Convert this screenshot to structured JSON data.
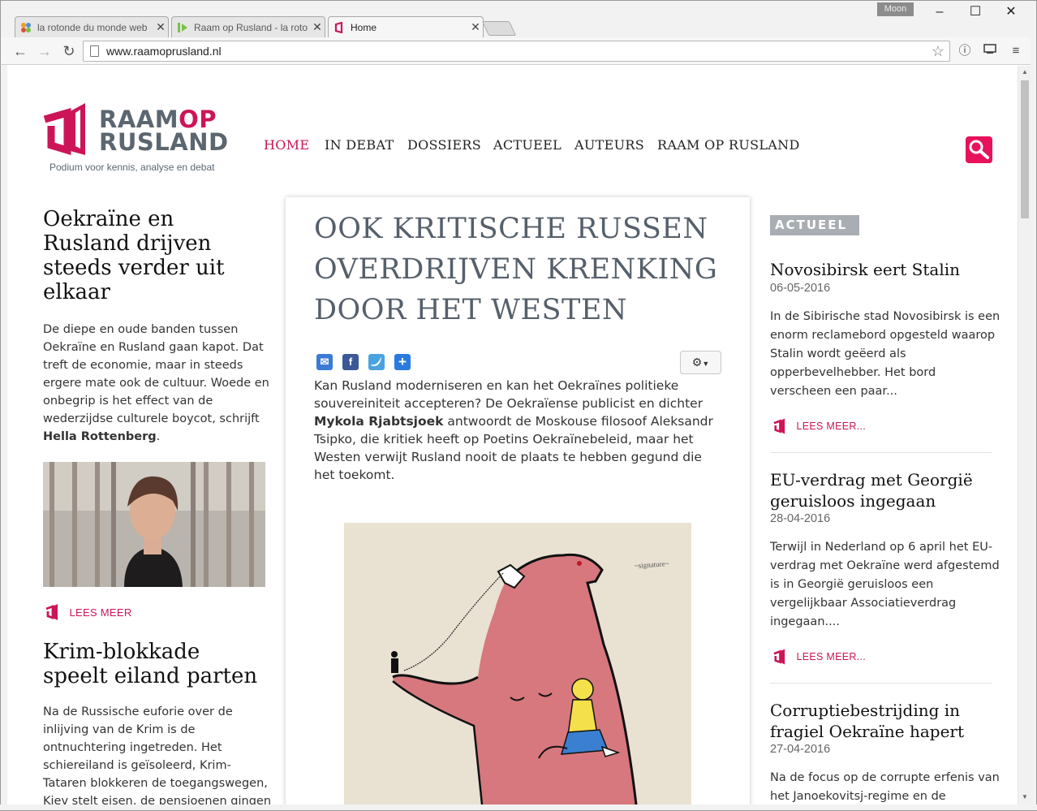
{
  "browser": {
    "tabs": [
      {
        "title": "la rotonde du monde web",
        "favicon": "joomla-icon"
      },
      {
        "title": "Raam op Rusland - la roto",
        "favicon": "green-play-icon"
      },
      {
        "title": "Home",
        "favicon": "raam-op-rusland-icon"
      }
    ],
    "active_tab": 2,
    "user": "Moon",
    "url": "www.raamoprusland.nl",
    "window_controls": {
      "minimize": "–",
      "maximize": "☐",
      "close": "✕"
    }
  },
  "site": {
    "logo": {
      "line1_grey": "RAAM",
      "line1_accent": "OP",
      "line2": "RUSLAND",
      "tagline": "Podium voor kennis, analyse en debat"
    },
    "nav": [
      "HOME",
      "IN DEBAT",
      "DOSSIERS",
      "ACTUEEL",
      "AUTEURS",
      "RAAM OP RUSLAND"
    ],
    "active_nav": "HOME",
    "accent_color": "#cc1557"
  },
  "left": {
    "story1": {
      "title_lines": [
        "Oekraïne en",
        "Rusland drijven",
        "steeds verder uit",
        "elkaar"
      ],
      "lines": [
        "De diepe en oude banden tussen",
        "Oekraïne en Rusland gaan kapot. Dat",
        "treft de economie, maar in steeds",
        "ergere mate ook de cultuur. Woede en",
        "onbegrip is het effect van de",
        "wederzijdse culturele boycot, schrijft"
      ],
      "author": "Hella Rottenberg",
      "author_suffix": ".",
      "lees_meer": "LEES MEER"
    },
    "story2": {
      "title_lines": [
        "Krim-blokkade",
        "speelt eiland parten"
      ],
      "lines": [
        "Na de Russische euforie over de",
        "inlijving van de Krim is de",
        "ontnuchtering ingetreden. Het",
        "schiereiland is geïsoleerd, Krim-",
        "Tataren blokkeren de toegangswegen,",
        "Kiev stelt eisen, de pensioenen gingen"
      ]
    }
  },
  "article": {
    "title_lines": [
      "OOK KRITISCHE RUSSEN",
      "OVERDRIJVEN KRENKING",
      "DOOR HET WESTEN"
    ],
    "share_icons": [
      "email-icon",
      "facebook-icon",
      "twitter-icon",
      "plus-icon"
    ],
    "intro_lines": [
      {
        "pre": "Kan Rusland moderniseren en kan het Oekraïnes politieke",
        "bold": "",
        "post": ""
      },
      {
        "pre": "souvereiniteit accepteren? De Oekraïense publicist en dichter",
        "bold": "",
        "post": ""
      },
      {
        "pre": "",
        "bold": "Mykola Rjabtsjoek",
        "post": " antwoordt de Moskouse filosoof Aleksandr"
      },
      {
        "pre": "Tsipko, die kritiek heeft op Poetins Oekraïnebeleid, maar het",
        "bold": "",
        "post": ""
      },
      {
        "pre": "Westen verwijt Rusland nooit de plaats te hebben gegund die",
        "bold": "",
        "post": ""
      },
      {
        "pre": "het toekomt.",
        "bold": "",
        "post": ""
      }
    ]
  },
  "right": {
    "section_label": "ACTUEEL",
    "items": [
      {
        "title_lines": [
          "Novosibirsk eert Stalin"
        ],
        "date": "06-05-2016",
        "lines": [
          "In de Sibirische stad Novosibirsk is een",
          "enorm reclamebord opgesteld waarop",
          "Stalin wordt geëerd als",
          "opperbevelhebber. Het bord",
          "verscheen een paar..."
        ],
        "lees_meer": "LEES MEER..."
      },
      {
        "title_lines": [
          "EU-verdrag met Georgië",
          "geruisloos ingegaan"
        ],
        "date": "28-04-2016",
        "lines": [
          "Terwijl in Nederland op 6 april het EU-",
          "verdrag met Oekraïne werd afgestemd",
          "is in Georgië geruisloos een",
          "vergelijkbaar Associatieverdrag",
          "ingegaan...."
        ],
        "lees_meer": "LEES MEER..."
      },
      {
        "title_lines": [
          "Corruptiebestrijding in",
          "fragiel Oekraïne hapert"
        ],
        "date": "27-04-2016",
        "lines": [
          "Na de focus op de corrupte erfenis van",
          "het Janoekovitsj-regime en de"
        ]
      }
    ]
  }
}
